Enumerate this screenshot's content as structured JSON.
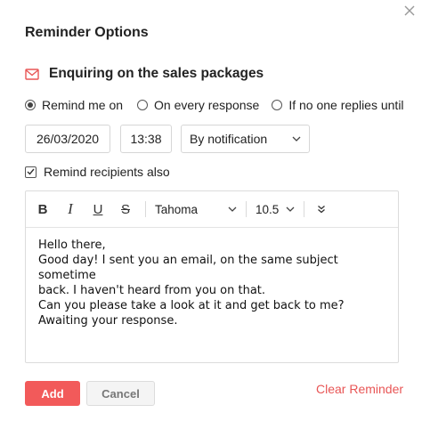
{
  "dialog": {
    "title": "Reminder Options",
    "close_icon": "close-icon"
  },
  "subject": {
    "icon": "mail-icon",
    "text": "Enquiring on the sales packages",
    "icon_color": "#e85555"
  },
  "remind_options": {
    "selected": "Remind me on",
    "options": [
      "Remind me on",
      "On every response",
      "If no one replies until"
    ]
  },
  "schedule": {
    "date": "26/03/2020",
    "time": "13:38",
    "method": "By notification"
  },
  "recipients": {
    "label": "Remind recipients also",
    "checked": true
  },
  "editor": {
    "toolbar": {
      "bold": "B",
      "italic": "I",
      "underline": "U",
      "strikethrough": "S",
      "font": "Tahoma",
      "size": "10.5"
    },
    "lines": [
      "Hello there,",
      "Good day! I sent you an email, on the same subject sometime",
      "back. I haven't heard from you on that.",
      "Can you please take a look at it and get back to me?",
      "Awaiting your response."
    ]
  },
  "actions": {
    "add": "Add",
    "cancel": "Cancel",
    "clear": "Clear Reminder"
  },
  "colors": {
    "accent": "#f25a5a",
    "link": "#e85555"
  }
}
